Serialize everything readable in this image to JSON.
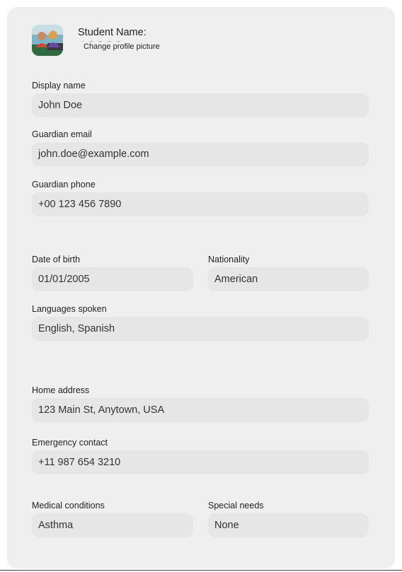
{
  "header": {
    "student_name_label": "Student Name:",
    "change_picture_link": "Change profile picture"
  },
  "fields": {
    "display_name": {
      "label": "Display name",
      "value": "John Doe"
    },
    "guardian_email": {
      "label": "Guardian email",
      "value": "john.doe@example.com"
    },
    "guardian_phone": {
      "label": "Guardian phone",
      "value": "+00 123 456 7890"
    },
    "date_of_birth": {
      "label": "Date of birth",
      "value": "01/01/2005"
    },
    "nationality": {
      "label": "Nationality",
      "value": "American"
    },
    "languages_spoken": {
      "label": "Languages spoken",
      "value": "English, Spanish"
    },
    "home_address": {
      "label": "Home address",
      "value": "123 Main St, Anytown, USA"
    },
    "emergency_contact": {
      "label": "Emergency contact",
      "value": "+11 987 654 3210"
    },
    "medical_conditions": {
      "label": "Medical conditions",
      "value": "Asthma"
    },
    "special_needs": {
      "label": "Special needs",
      "value": "None"
    }
  },
  "colors": {
    "card_background": "#efefef",
    "input_background": "#e6e6e6"
  }
}
